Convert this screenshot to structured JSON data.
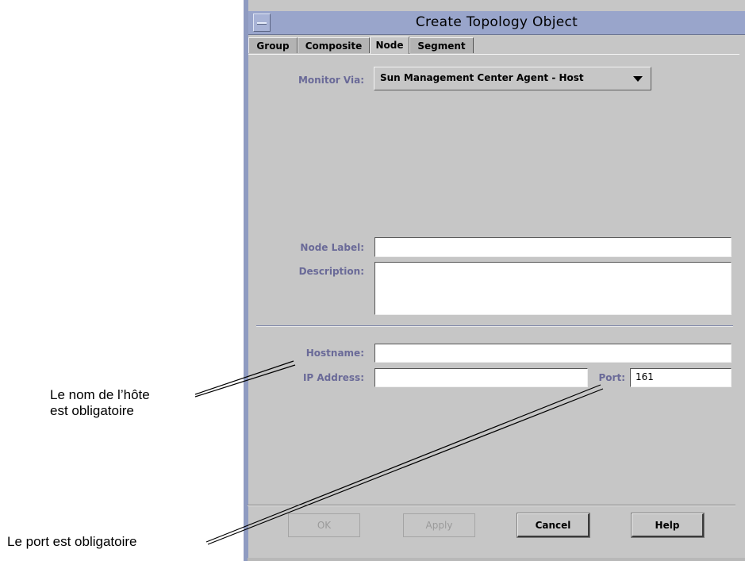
{
  "window": {
    "title": "Create Topology Object"
  },
  "tabs": [
    {
      "label": "Group",
      "active": false
    },
    {
      "label": "Composite",
      "active": false
    },
    {
      "label": "Node",
      "active": true
    },
    {
      "label": "Segment",
      "active": false
    }
  ],
  "form": {
    "monitor_via_label": "Monitor Via:",
    "monitor_via_value": "Sun Management Center Agent - Host",
    "node_label_label": "Node Label:",
    "node_label_value": "",
    "description_label": "Description:",
    "description_value": "",
    "hostname_label": "Hostname:",
    "hostname_value": "",
    "ip_address_label": "IP Address:",
    "ip_address_value": "",
    "port_label": "Port:",
    "port_value": "161"
  },
  "buttons": {
    "ok": "OK",
    "apply": "Apply",
    "cancel": "Cancel",
    "help": "Help"
  },
  "callouts": {
    "hostname_required_line1": "Le nom de l’hôte",
    "hostname_required_line2": "est obligatoire",
    "port_required": "Le port est obligatoire"
  },
  "colors": {
    "titlebar": "#99a5cb",
    "panel": "#c6c6c6",
    "label_text": "#6a6a98"
  }
}
